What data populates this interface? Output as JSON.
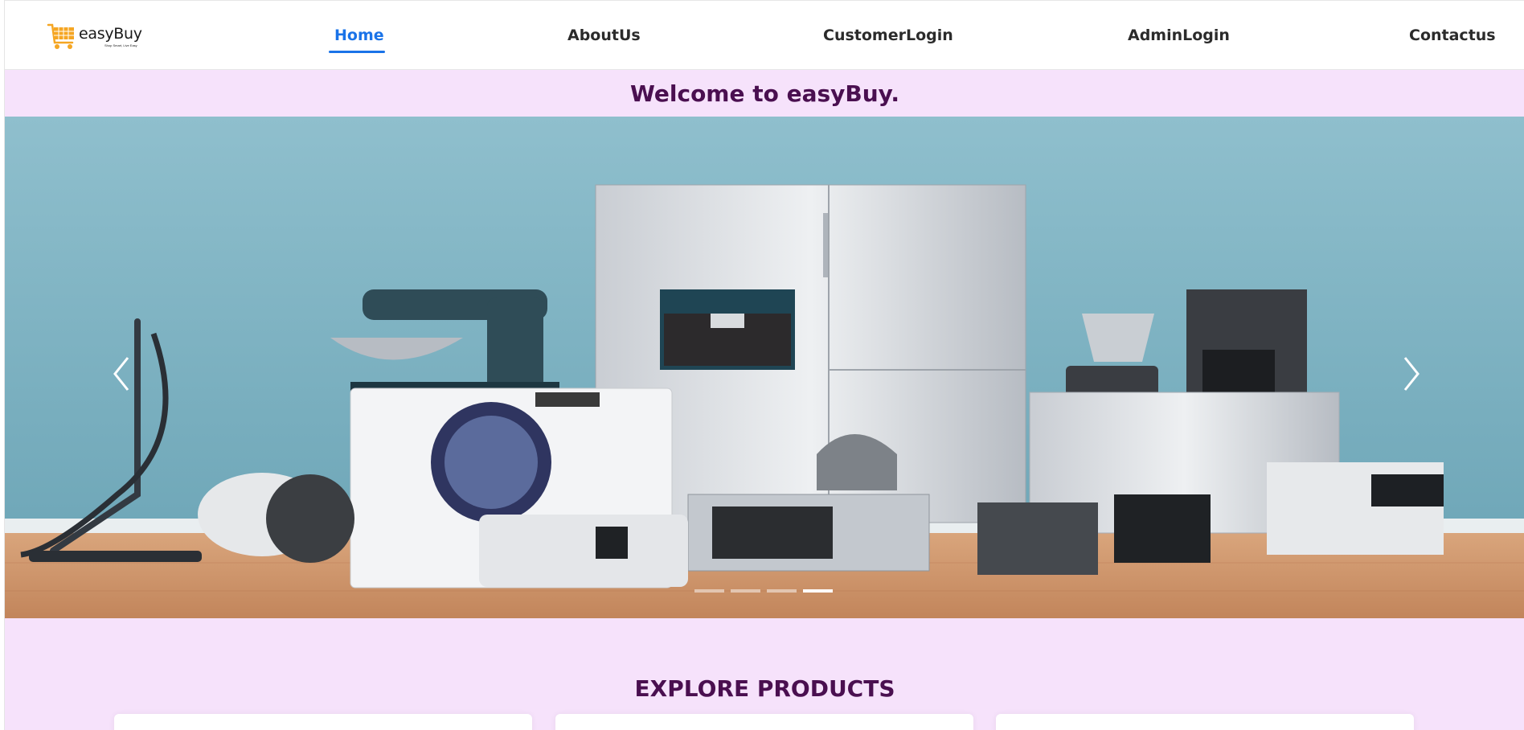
{
  "brand": {
    "name": "easyBuy",
    "tagline": "Shop Smart, Live Easy",
    "accent": "#f5a623"
  },
  "nav": {
    "items": [
      {
        "label": "Home",
        "active": true
      },
      {
        "label": "AboutUs"
      },
      {
        "label": "CustomerLogin"
      },
      {
        "label": "AdminLogin"
      },
      {
        "label": "Contactus"
      }
    ],
    "active_color": "#1a73e8"
  },
  "welcome": {
    "text": "Welcome to easyBuy."
  },
  "carousel": {
    "prev_icon": "chevron-left-icon",
    "next_icon": "chevron-right-icon",
    "slide_count": 4,
    "active_slide": 4
  },
  "products": {
    "heading": "EXPLORE PRODUCTS"
  },
  "colors": {
    "page_bg": "#f6e2fb",
    "heading": "#4a0f50"
  }
}
